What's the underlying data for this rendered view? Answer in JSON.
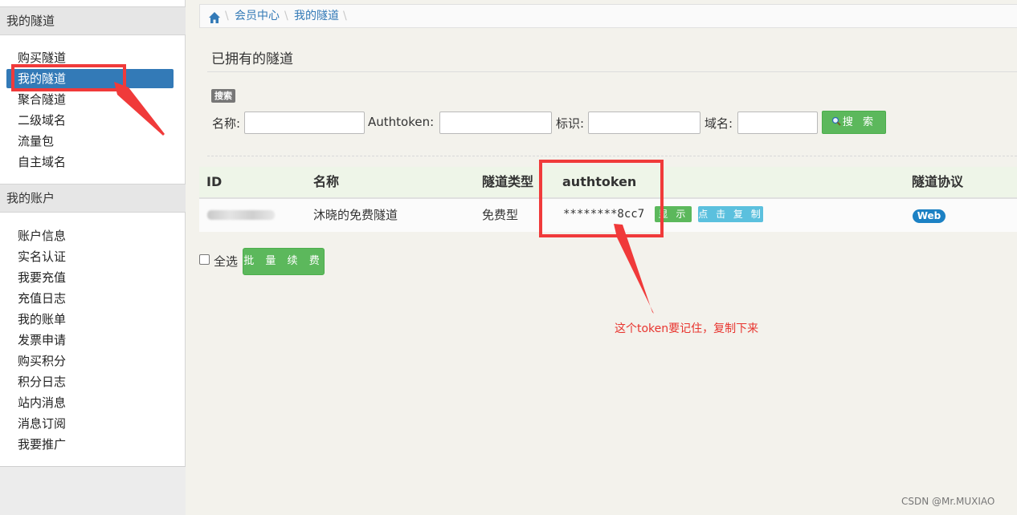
{
  "sidebar": {
    "section1_title": "我的隧道",
    "section1_items": [
      "购买隧道",
      "我的隧道",
      "聚合隧道",
      "二级域名",
      "流量包",
      "自主域名"
    ],
    "section2_title": "我的账户",
    "section2_items": [
      "账户信息",
      "实名认证",
      "我要充值",
      "充值日志",
      "我的账单",
      "发票申请",
      "购买积分",
      "积分日志",
      "站内消息",
      "消息订阅",
      "我要推广"
    ]
  },
  "breadcrumb": {
    "home_icon": "home-icon",
    "items": [
      "会员中心",
      "我的隧道"
    ]
  },
  "page": {
    "title": "已拥有的隧道",
    "search_tag": "搜索"
  },
  "filters": {
    "name_label": "名称:",
    "name_value": "",
    "authtoken_label": "Authtoken:",
    "authtoken_value": "",
    "tag_label": "标识:",
    "tag_value": "",
    "domain_label": "域名:",
    "domain_value": "",
    "search_button": "搜 索",
    "search_icon": "magnifier-icon"
  },
  "table": {
    "headers": [
      "ID",
      "名称",
      "隧道类型",
      "authtoken",
      "隧道协议"
    ],
    "rows": [
      {
        "name": "沐晓的免费隧道",
        "type": "免费型",
        "authtoken": "********8cc7",
        "show_button": "显 示",
        "copy_button": "点 击 复 制",
        "protocol": "Web"
      }
    ]
  },
  "footer_actions": {
    "select_all": "全选",
    "batch_renew": "批 量 续 费"
  },
  "annotation": {
    "note": "这个token要记住，复制下来",
    "color": "#f03a3a"
  },
  "watermark": "CSDN @Mr.MUXIAO"
}
